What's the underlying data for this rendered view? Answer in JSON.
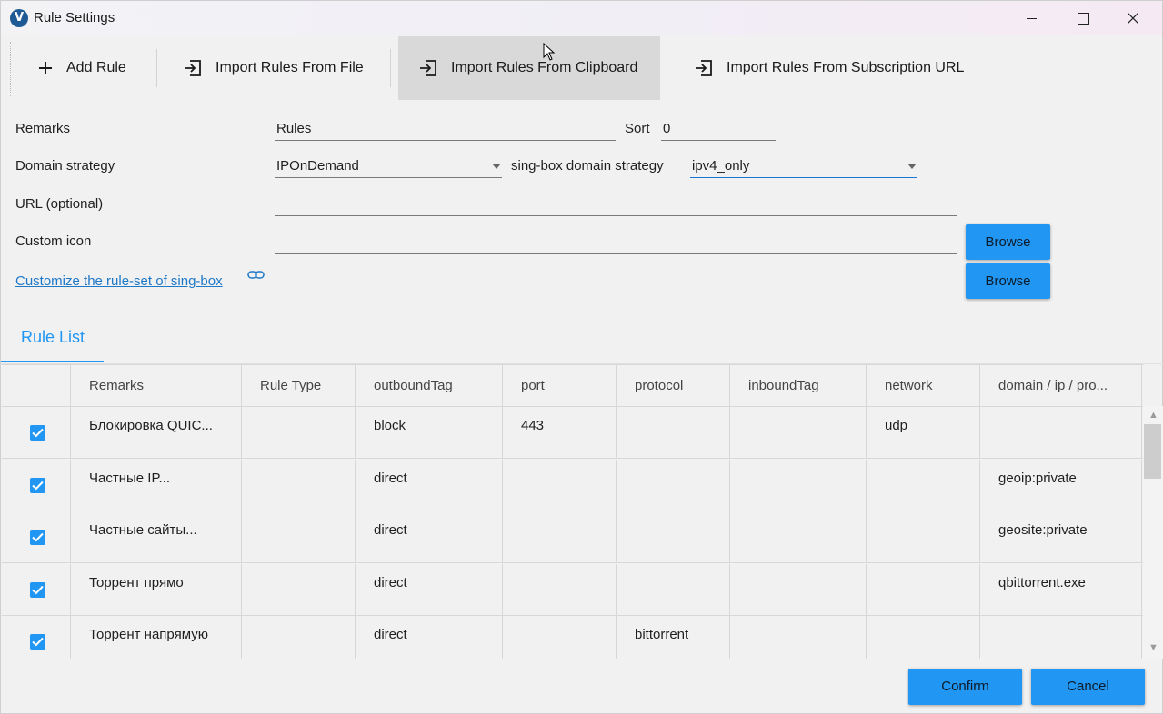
{
  "window": {
    "title": "Rule Settings",
    "app_icon_letter": "V"
  },
  "toolbar": {
    "add_rule": "Add Rule",
    "import_file": "Import Rules From File",
    "import_clipboard": "Import Rules From Clipboard",
    "import_url": "Import Rules From Subscription URL"
  },
  "form": {
    "remarks_label": "Remarks",
    "remarks_value": "Rules",
    "sort_label": "Sort",
    "sort_value": "0",
    "domain_strategy_label": "Domain strategy",
    "domain_strategy_value": "IPOnDemand",
    "singbox_domain_strategy_label": "sing-box domain strategy",
    "singbox_domain_strategy_value": "ipv4_only",
    "url_label": "URL (optional)",
    "url_value": "",
    "custom_icon_label": "Custom icon",
    "custom_icon_value": "",
    "ruleset_link": "Customize the rule-set of sing-box",
    "ruleset_value": "",
    "browse_label": "Browse"
  },
  "tabs": {
    "rule_list": "Rule List"
  },
  "table": {
    "columns": [
      "Remarks",
      "Rule Type",
      "outboundTag",
      "port",
      "protocol",
      "inboundTag",
      "network",
      "domain / ip / pro..."
    ],
    "rows": [
      {
        "checked": true,
        "remarks": "Блокировка QUIC...",
        "rule_type": "",
        "outbound": "block",
        "port": "443",
        "protocol": "",
        "inbound": "",
        "network": "udp",
        "domain": ""
      },
      {
        "checked": true,
        "remarks": "Частные IP...",
        "rule_type": "",
        "outbound": "direct",
        "port": "",
        "protocol": "",
        "inbound": "",
        "network": "",
        "domain": "geoip:private"
      },
      {
        "checked": true,
        "remarks": "Частные сайты...",
        "rule_type": "",
        "outbound": "direct",
        "port": "",
        "protocol": "",
        "inbound": "",
        "network": "",
        "domain": "geosite:private"
      },
      {
        "checked": true,
        "remarks": "Торрент прямо",
        "rule_type": "",
        "outbound": "direct",
        "port": "",
        "protocol": "",
        "inbound": "",
        "network": "",
        "domain": "qbittorrent.exe"
      },
      {
        "checked": true,
        "remarks": "Торрент напрямую",
        "rule_type": "",
        "outbound": "direct",
        "port": "",
        "protocol": "bittorrent",
        "inbound": "",
        "network": "",
        "domain": ""
      }
    ]
  },
  "footer": {
    "confirm": "Confirm",
    "cancel": "Cancel"
  },
  "colors": {
    "accent": "#2196f3",
    "link": "#1e78c8",
    "toolbar_hover": "#d9d9d9"
  }
}
